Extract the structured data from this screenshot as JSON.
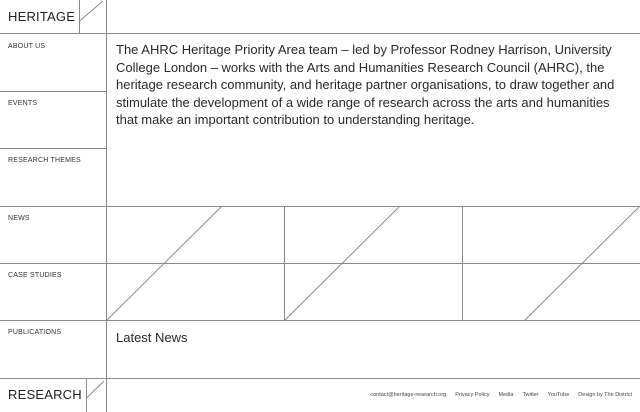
{
  "brand": {
    "top_logo": "HERITAGE",
    "bottom_logo": "RESEARCH"
  },
  "nav": {
    "items": [
      {
        "label": "ABOUT US"
      },
      {
        "label": "EVENTS"
      },
      {
        "label": "RESEARCH THEMES"
      },
      {
        "label": "NEWS"
      },
      {
        "label": "CASE STUDIES"
      },
      {
        "label": "PUBLICATIONS"
      }
    ]
  },
  "main": {
    "intro": "The AHRC Heritage Priority Area team – led by Professor Rodney Harrison, University College London – works with the Arts and Humanities Research Council (AHRC), the heritage research community, and heritage partner organisations, to draw together and stimulate the development of a wide range of research across the arts and humanities that make an important contribution to understanding heritage.",
    "latest_news_heading": "Latest News"
  },
  "footer": {
    "links": [
      {
        "label": "contact@heritage-research.org"
      },
      {
        "label": "Privacy Policy"
      },
      {
        "label": "Media"
      },
      {
        "label": "Twitter"
      },
      {
        "label": "YouTube"
      },
      {
        "label": "Design by The District"
      }
    ]
  },
  "colors": {
    "line": "#8a8a8a",
    "text": "#2a2a2a",
    "background": "#ffffff"
  }
}
